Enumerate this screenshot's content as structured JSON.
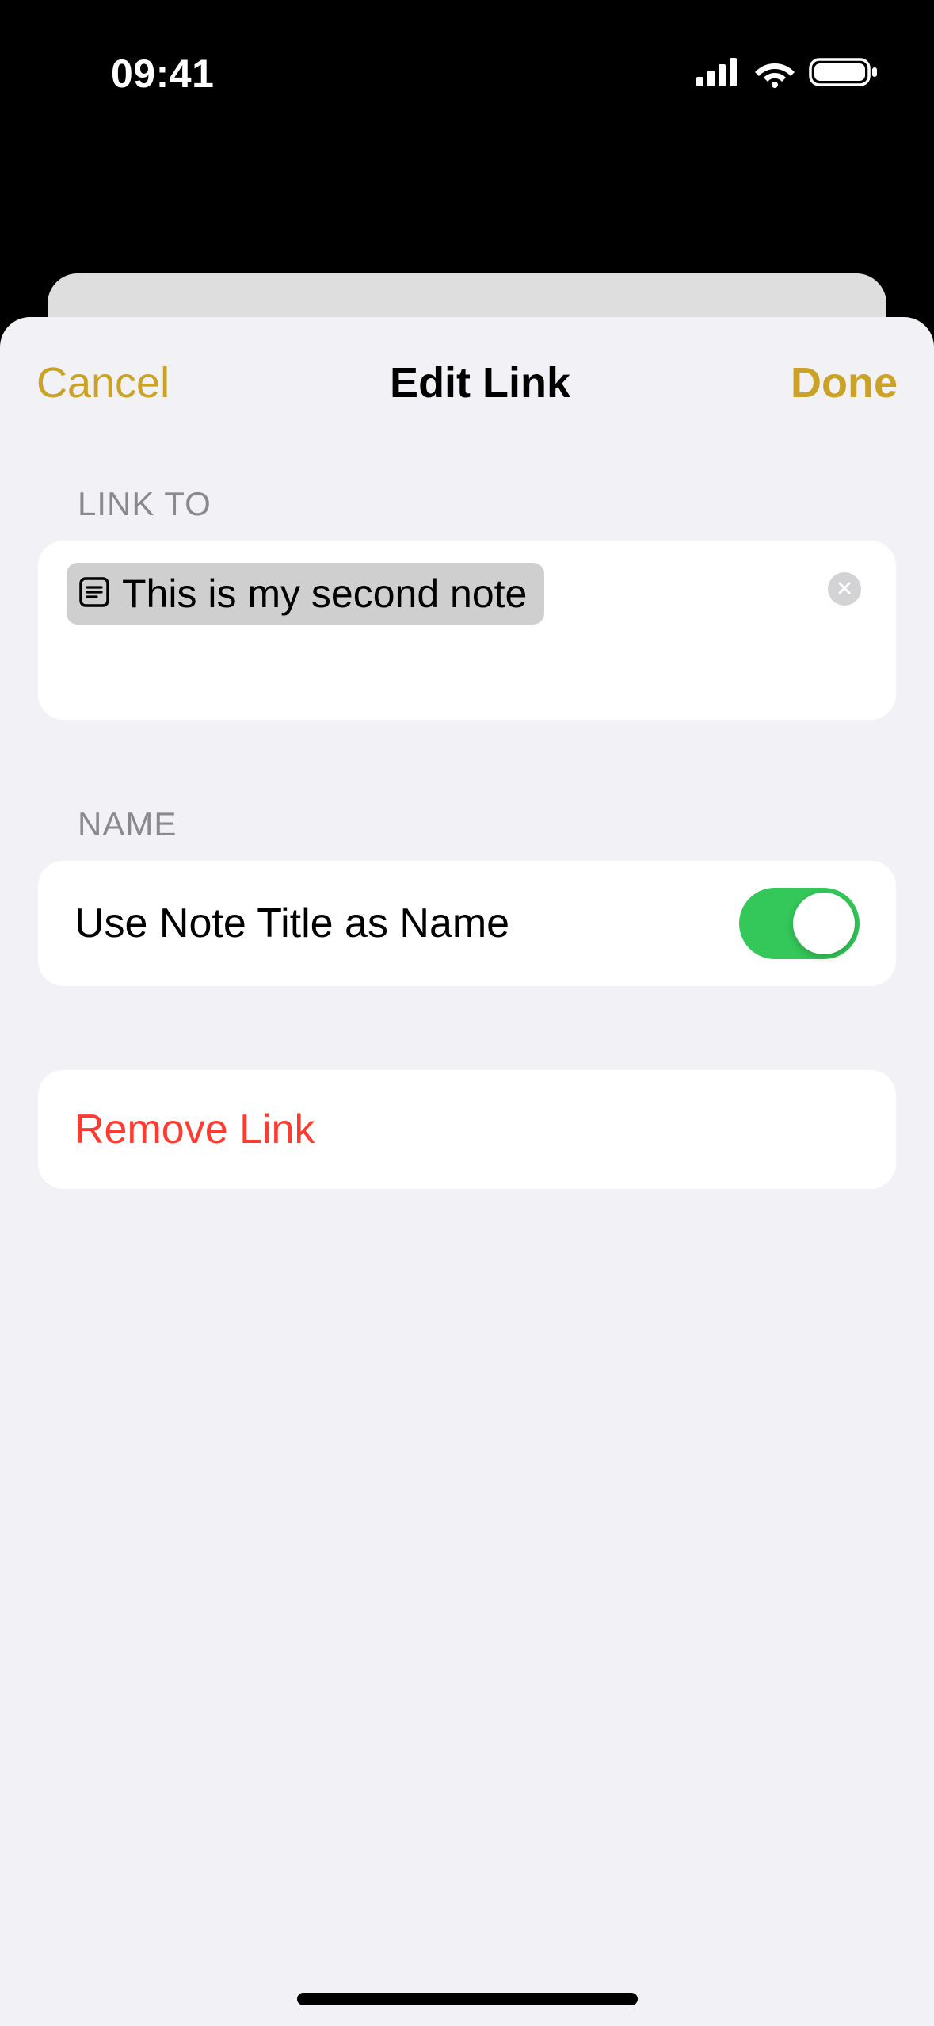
{
  "status": {
    "time": "09:41"
  },
  "sheet": {
    "cancel_label": "Cancel",
    "title": "Edit Link",
    "done_label": "Done"
  },
  "link_to": {
    "header": "LINK TO",
    "chip_text": "This is my second note"
  },
  "name": {
    "header": "NAME",
    "toggle_label": "Use Note Title as Name",
    "toggle_on": true
  },
  "remove": {
    "label": "Remove Link"
  },
  "colors": {
    "accent": "#c9a227",
    "destructive": "#ff3b30",
    "toggle_on": "#34c759"
  }
}
